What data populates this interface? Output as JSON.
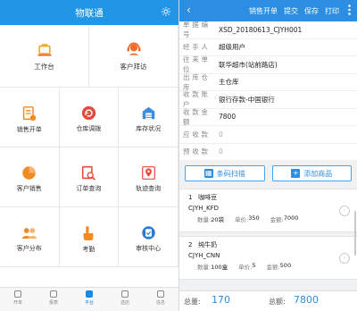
{
  "left": {
    "title": "物联通",
    "big_cells": [
      {
        "label": "工作台",
        "icon": "briefcase-icon",
        "color": "#f3a21d"
      },
      {
        "label": "客户拜访",
        "icon": "headset-icon",
        "color": "#f26b2a"
      }
    ],
    "small_cells": [
      {
        "label": "销售开单",
        "icon": "invoice-icon",
        "color": "#f08a24"
      },
      {
        "label": "仓库调拨",
        "icon": "transfer-icon",
        "color": "#e84a3a"
      },
      {
        "label": "库存状况",
        "icon": "warehouse-icon",
        "color": "#3b8fe0"
      },
      {
        "label": "客户销售",
        "icon": "pie-chart-icon",
        "color": "#f08a24"
      },
      {
        "label": "订单查询",
        "icon": "order-search-icon",
        "color": "#e84a3a"
      },
      {
        "label": "轨迹查询",
        "icon": "location-pin-icon",
        "color": "#e84a3a"
      },
      {
        "label": "客户分布",
        "icon": "people-icon",
        "color": "#f08a24"
      },
      {
        "label": "考勤",
        "icon": "hand-pointer-icon",
        "color": "#f08a24"
      },
      {
        "label": "审核中心",
        "icon": "approval-icon",
        "color": "#2d7bd0"
      }
    ],
    "tabs": [
      {
        "label": "开单",
        "active": false
      },
      {
        "label": "报表",
        "active": false
      },
      {
        "label": "平台",
        "active": true
      },
      {
        "label": "选店",
        "active": false
      },
      {
        "label": "信息",
        "active": false
      }
    ]
  },
  "right": {
    "header": {
      "back": "‹",
      "actions": [
        "销售开单",
        "提交",
        "保存",
        "打印"
      ]
    },
    "fields": [
      {
        "label": "单据编号",
        "value": "XSD_20180613_CJYH001",
        "placeholder": false
      },
      {
        "label": "经手人",
        "value": "超级用户",
        "placeholder": false
      },
      {
        "label": "往来单位",
        "value": "联华超市(站前路店)",
        "placeholder": false
      },
      {
        "label": "出库仓库",
        "value": "主仓库",
        "placeholder": false
      },
      {
        "label": "收款账户",
        "value": "银行存款-中国银行",
        "placeholder": false
      },
      {
        "label": "收款金额",
        "value": "7800",
        "placeholder": false
      },
      {
        "label": "应收款",
        "value": "0",
        "placeholder": true
      },
      {
        "label": "预收款",
        "value": "0",
        "placeholder": true
      }
    ],
    "buttons": {
      "scan": "条码扫描",
      "add": "添加商品"
    },
    "items": [
      {
        "index": "1",
        "name": "咖啡豆",
        "code": "CJYH_KFD",
        "qty_label": "数量:",
        "qty": "20袋",
        "price_label": "单价:",
        "price": "350",
        "amount_label": "金额:",
        "amount": "7000"
      },
      {
        "index": "2",
        "name": "纯牛奶",
        "code": "CJYH_CNN",
        "qty_label": "数量:",
        "qty": "100盒",
        "price_label": "单价:",
        "price": "5",
        "amount_label": "金额:",
        "amount": "500"
      }
    ],
    "footer": {
      "qty_label": "总量:",
      "qty": "170",
      "amount_label": "总额:",
      "amount": "7800"
    }
  },
  "colors": {
    "primary": "#2196e6",
    "accent_blue": "#2b8ee0"
  }
}
